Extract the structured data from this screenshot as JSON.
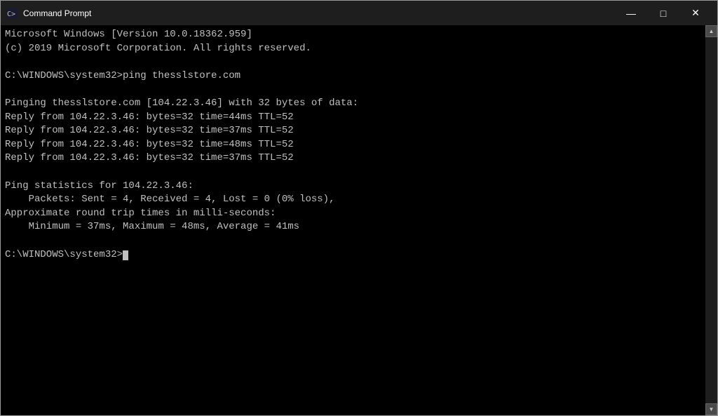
{
  "window": {
    "title": "Command Prompt",
    "controls": {
      "minimize": "—",
      "maximize": "□",
      "close": "✕"
    }
  },
  "terminal": {
    "lines": [
      "Microsoft Windows [Version 10.0.18362.959]",
      "(c) 2019 Microsoft Corporation. All rights reserved.",
      "",
      "C:\\WINDOWS\\system32>ping thesslstore.com",
      "",
      "Pinging thesslstore.com [104.22.3.46] with 32 bytes of data:",
      "Reply from 104.22.3.46: bytes=32 time=44ms TTL=52",
      "Reply from 104.22.3.46: bytes=32 time=37ms TTL=52",
      "Reply from 104.22.3.46: bytes=32 time=48ms TTL=52",
      "Reply from 104.22.3.46: bytes=32 time=37ms TTL=52",
      "",
      "Ping statistics for 104.22.3.46:",
      "    Packets: Sent = 4, Received = 4, Lost = 0 (0% loss),",
      "Approximate round trip times in milli-seconds:",
      "    Minimum = 37ms, Maximum = 48ms, Average = 41ms",
      "",
      "C:\\WINDOWS\\system32>"
    ]
  }
}
